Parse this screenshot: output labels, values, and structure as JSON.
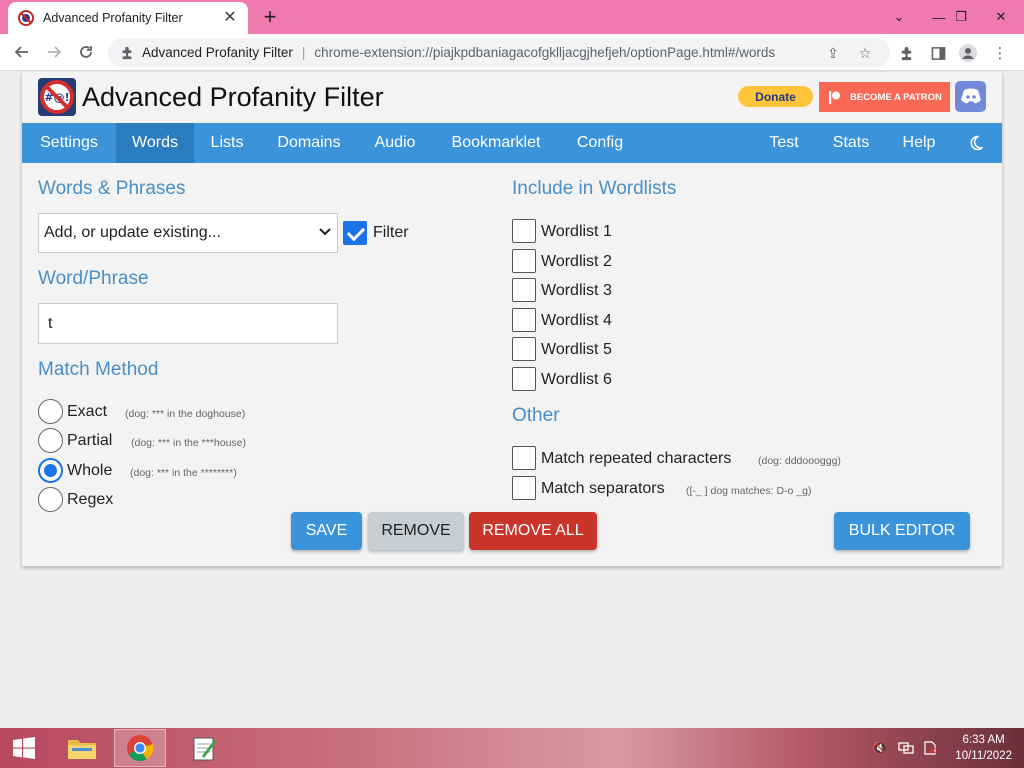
{
  "browser": {
    "tab_title": "Advanced Profanity Filter",
    "site_chip": "Advanced Profanity Filter",
    "url": "chrome-extension://piajkpdbaniagacofgklljacgjhefjeh/optionPage.html#/words"
  },
  "header": {
    "title": "Advanced Profanity Filter",
    "donate_label": "Donate",
    "patron_label": "BECOME A PATRON"
  },
  "nav": {
    "settings": "Settings",
    "words": "Words",
    "lists": "Lists",
    "domains": "Domains",
    "audio": "Audio",
    "bookmarklet": "Bookmarklet",
    "config": "Config",
    "test": "Test",
    "stats": "Stats",
    "help": "Help",
    "active": "Words"
  },
  "words": {
    "section_title": "Words & Phrases",
    "select_value": "Add, or update existing...",
    "filter_label": "Filter",
    "filter_checked": true,
    "word_title": "Word/Phrase",
    "word_value": "t",
    "match_title": "Match Method",
    "methods": [
      {
        "label": "Exact",
        "hint": "(dog: *** in the doghouse)",
        "checked": false
      },
      {
        "label": "Partial",
        "hint": "(dog: *** in the ***house)",
        "checked": false
      },
      {
        "label": "Whole",
        "hint": "(dog: *** in the ********)",
        "checked": true
      },
      {
        "label": "Regex",
        "hint": "",
        "checked": false
      }
    ]
  },
  "wordlists": {
    "title": "Include in Wordlists",
    "items": [
      "Wordlist 1",
      "Wordlist 2",
      "Wordlist 3",
      "Wordlist 4",
      "Wordlist 5",
      "Wordlist 6"
    ]
  },
  "other": {
    "title": "Other",
    "repeated_label": "Match repeated characters",
    "repeated_hint": "(dog: dddoooggg)",
    "separators_label": "Match separators",
    "separators_hint": "([-_ ] dog matches: D-o _g)"
  },
  "buttons": {
    "save": "SAVE",
    "remove": "REMOVE",
    "remove_all": "REMOVE ALL",
    "bulk_editor": "BULK EDITOR"
  },
  "taskbar": {
    "time": "6:33 AM",
    "date": "10/11/2022"
  },
  "colors": {
    "nav_bg": "#3b93d9",
    "nav_active": "#2a7ec0",
    "accent_text": "#4a8fc7",
    "save": "#3b93d9",
    "remove": "#c8cdd2",
    "remove_all": "#c9352b",
    "patron": "#f96854",
    "donate": "#ffc439",
    "discord": "#7289da"
  }
}
